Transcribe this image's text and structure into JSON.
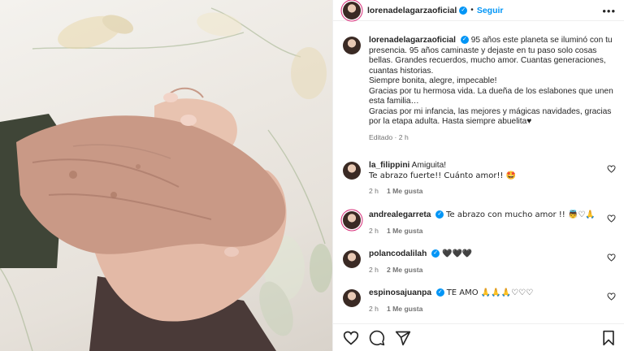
{
  "post": {
    "username": "lorenadelagarzaoficial",
    "follow_label": "Seguir",
    "caption_lines": [
      "95 años este planeta se iluminó con tu presencia. 95 años caminaste y dejaste en tu paso solo cosas bellas. Grandes recuerdos, mucho amor. Cuantas generaciones, cuantas historias.",
      "Siempre bonita, alegre, impecable!",
      "Gracias por tu hermosa vida. La dueña de los eslabones que unen esta familia…",
      "Gracias por mi infancia, las mejores y mágicas navidades, gracias por la etapa adulta. Hasta siempre abuelita♥"
    ],
    "caption_meta": "Editado · 2 h"
  },
  "comments": [
    {
      "user": "la_filippini",
      "verified": false,
      "text_lines": [
        "Amiguita!",
        "Te abrazo fuerte!! Cuánto amor!! 🤩"
      ],
      "time": "2 h",
      "likes": "1 Me gusta"
    },
    {
      "user": "andrealegarreta",
      "verified": true,
      "text_lines": [
        "Te abrazo con mucho amor !! 👼♡🙏"
      ],
      "time": "2 h",
      "likes": "1 Me gusta"
    },
    {
      "user": "polancodalilah",
      "verified": true,
      "text_lines": [
        "🖤🖤🖤"
      ],
      "time": "2 h",
      "likes": "2 Me gusta"
    },
    {
      "user": "espinosajuanpa",
      "verified": true,
      "text_lines": [
        "TE AMO 🙏🙏🙏♡♡♡"
      ],
      "time": "2 h",
      "likes": "1 Me gusta"
    }
  ],
  "icons": {
    "more": "more-options-icon",
    "like": "heart-icon",
    "comment": "comment-icon",
    "share": "share-icon",
    "save": "bookmark-icon",
    "verified": "verified-badge-icon"
  },
  "colors": {
    "accent": "#0095f6",
    "text": "#262626",
    "muted": "#737373"
  }
}
